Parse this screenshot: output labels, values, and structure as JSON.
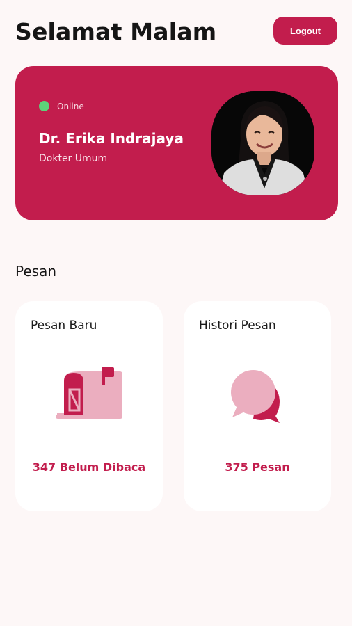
{
  "header": {
    "greeting": "Selamat Malam",
    "logout_label": "Logout"
  },
  "profile": {
    "status": "Online",
    "name": "Dr. Erika Indrajaya",
    "role": "Dokter Umum"
  },
  "messages": {
    "section_title": "Pesan",
    "cards": [
      {
        "title": "Pesan Baru",
        "count_label": "347 Belum Dibaca",
        "icon": "mailbox-icon"
      },
      {
        "title": "Histori Pesan",
        "count_label": "375 Pesan",
        "icon": "chat-bubbles-icon"
      }
    ]
  },
  "colors": {
    "brand": "#c21d4d",
    "brand_light": "#ebaebf",
    "background": "#fdf7f7",
    "online": "#5dd37a"
  }
}
